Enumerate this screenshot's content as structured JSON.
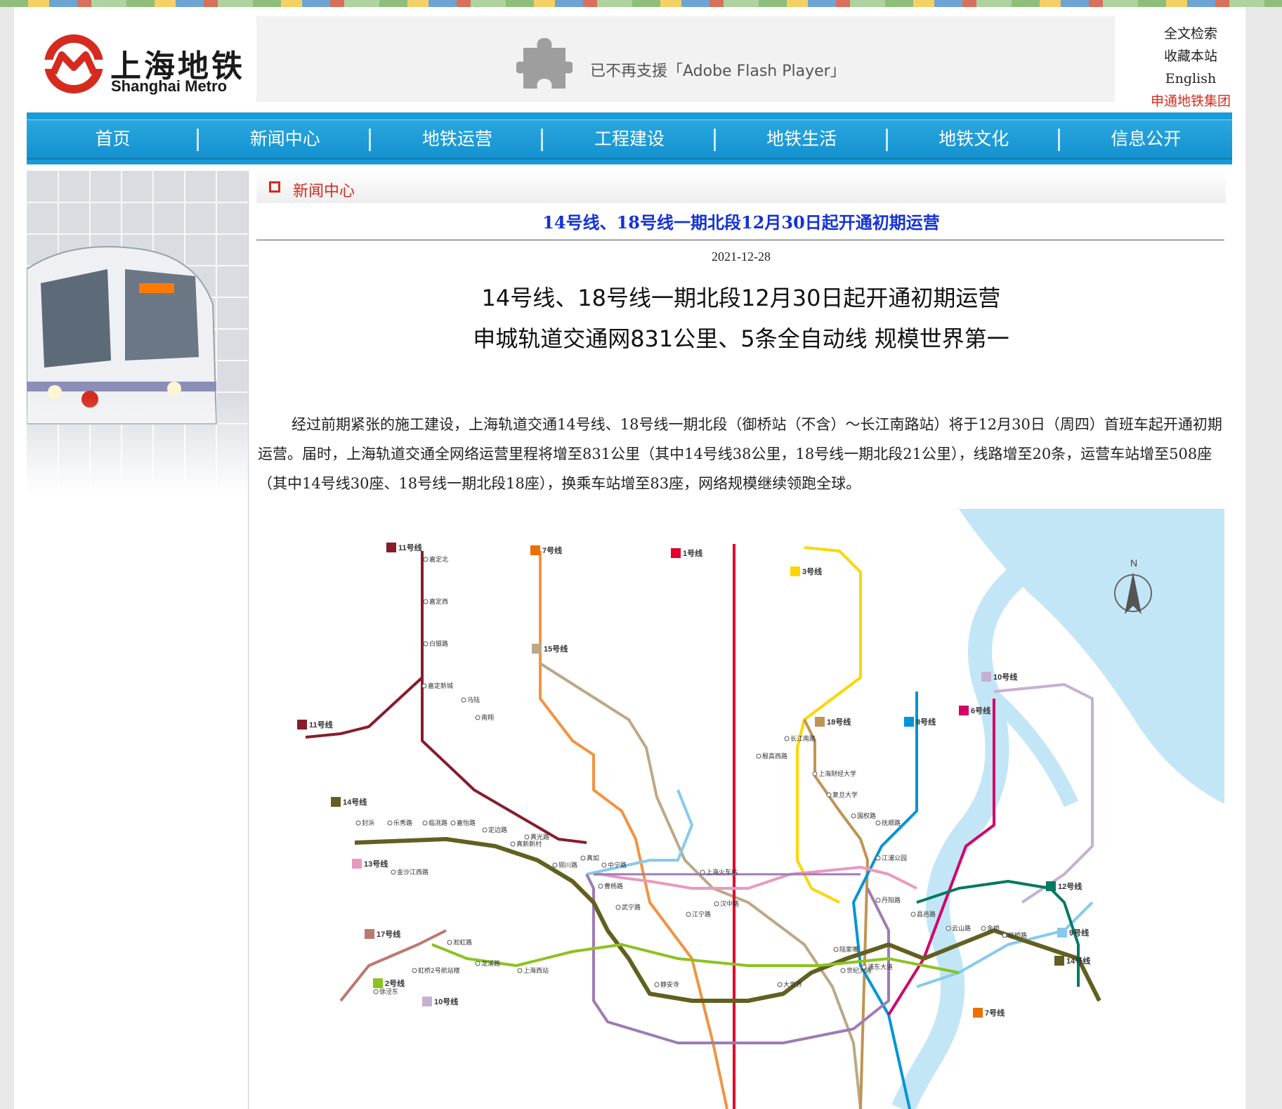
{
  "header": {
    "logo_cn": "上海地铁",
    "logo_en": "Shanghai Metro",
    "flash_notice": "已不再支援「Adobe Flash Player」",
    "top_links": [
      "全文检索",
      "收藏本站",
      "English",
      "申通地铁集团"
    ]
  },
  "nav": {
    "items": [
      "首页",
      "新闻中心",
      "地铁运营",
      "工程建设",
      "地铁生活",
      "地铁文化",
      "信息公开"
    ]
  },
  "breadcrumb": "新闻中心",
  "article": {
    "headline": "14号线、18号线一期北段12月30日起开通初期运营",
    "date": "2021-12-28",
    "title_line1": "14号线、18号线一期北段12月30日起开通初期运营",
    "title_line2": "申城轨道交通网831公里、5条全自动线  规模世界第一",
    "body": "经过前期紧张的施工建设，上海轨道交通14号线、18号线一期北段（御桥站（不含）～长江南路站）将于12月30日（周四）首班车起开通初期运营。届时，上海轨道交通全网络运营里程将增至831公里（其中14号线38公里，18号线一期北段21公里），线路增至20条，运营车站增至508座（其中14号线30座、18号线一期北段18座），换乘车站增至83座，网络规模继续领跑全球。"
  },
  "map": {
    "compass": "N",
    "line_badges": [
      "11号线",
      "7号线",
      "1号线",
      "3号线",
      "15号线",
      "18号线",
      "8号线",
      "6号线",
      "10号线",
      "14号线",
      "13号线",
      "17号线",
      "2号线",
      "10号线",
      "12号线",
      "9号线",
      "14号线",
      "7号线",
      "11号线"
    ],
    "stations": [
      "嘉定北",
      "嘉定西",
      "白银路",
      "嘉定新城",
      "马陆",
      "南翔",
      "封浜",
      "乐秀路",
      "临洮路",
      "嘉怡路",
      "定边路",
      "真新新村",
      "真光路",
      "铜川路",
      "真如",
      "中宁路",
      "曹杨路",
      "武宁路",
      "静安寺",
      "长江南路",
      "殷高西路",
      "上海财经大学",
      "复旦大学",
      "国权路",
      "抚顺路",
      "江浦公园",
      "丹阳路",
      "昌邑路",
      "陆家嘴",
      "世纪大道",
      "浦东大道",
      "大世界",
      "云山路",
      "金桥",
      "桂桥路",
      "上海火车站",
      "汉中路",
      "江宁路",
      "金沙江西路",
      "虹桥2号航站楼",
      "徐泾东",
      "淞虹路",
      "龙溪路",
      "上海西站"
    ],
    "colors": {
      "line1": "#e3002b",
      "line2": "#8cc220",
      "line3": "#fcd600",
      "line4": "#461d84",
      "line5": "#944d9a",
      "line6": "#d40068",
      "line7": "#ed6f00",
      "line8": "#0094d8",
      "line9": "#87caed",
      "line10": "#c6afd4",
      "line11": "#871c2b",
      "line12": "#007a60",
      "line13": "#e999c0",
      "line14": "#626020",
      "line15": "#bca886",
      "line16": "#98d1c0",
      "line17": "#bb796f",
      "line18": "#c09453",
      "water": "#c3e6f7"
    }
  }
}
